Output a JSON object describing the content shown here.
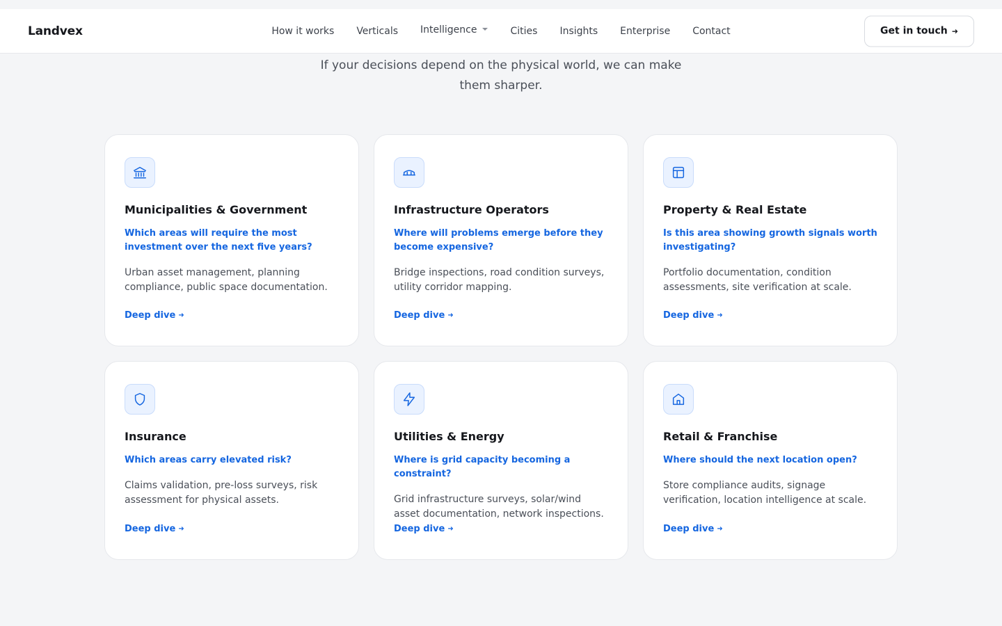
{
  "brand": "Landvex",
  "nav": {
    "items": [
      {
        "label": "How it works"
      },
      {
        "label": "Verticals"
      },
      {
        "label": "Intelligence",
        "has_dropdown": true
      },
      {
        "label": "Cities"
      },
      {
        "label": "Insights"
      },
      {
        "label": "Enterprise"
      },
      {
        "label": "Contact"
      }
    ],
    "cta": {
      "label": "Get in touch",
      "icon": "arrow-right-icon"
    }
  },
  "intro": {
    "text": "If your decisions depend on the physical world, we can make them sharper."
  },
  "colors": {
    "accent": "#1566e0",
    "icon_bg": "#eaf2ff",
    "page_bg": "#f4f5f7"
  },
  "verticals": [
    {
      "icon": "government-building-icon",
      "title": "Municipalities & Government",
      "question": "Which areas will require the most investment over the next five years?",
      "description": "Urban asset management, planning compliance, public space documentation.",
      "link": "Deep dive"
    },
    {
      "icon": "bridge-icon",
      "title": "Infrastructure Operators",
      "question": "Where will problems emerge before they become expensive?",
      "description": "Bridge inspections, road condition surveys, utility corridor mapping.",
      "link": "Deep dive"
    },
    {
      "icon": "layout-icon",
      "title": "Property & Real Estate",
      "question": "Is this area showing growth signals worth investigating?",
      "description": "Portfolio documentation, condition assessments, site verification at scale.",
      "link": "Deep dive"
    },
    {
      "icon": "shield-icon",
      "title": "Insurance",
      "question": "Which areas carry elevated risk?",
      "description": "Claims validation, pre-loss surveys, risk assessment for physical assets.",
      "link": "Deep dive"
    },
    {
      "icon": "lightning-icon",
      "title": "Utilities & Energy",
      "question": "Where is grid capacity becoming a constraint?",
      "description": "Grid infrastructure surveys, solar/wind asset documentation, network inspections.",
      "link": "Deep dive"
    },
    {
      "icon": "house-icon",
      "title": "Retail & Franchise",
      "question": "Where should the next location open?",
      "description": "Store compliance audits, signage verification, location intelligence at scale.",
      "link": "Deep dive"
    }
  ]
}
